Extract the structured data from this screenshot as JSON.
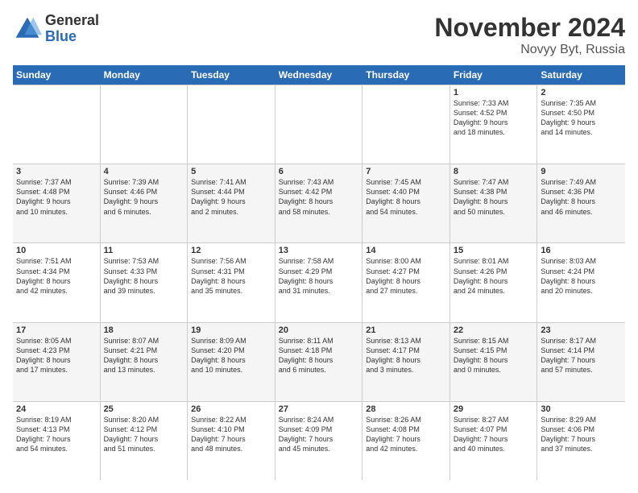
{
  "logo": {
    "general": "General",
    "blue": "Blue"
  },
  "title": "November 2024",
  "location": "Novyy Byt, Russia",
  "weekdays": [
    "Sunday",
    "Monday",
    "Tuesday",
    "Wednesday",
    "Thursday",
    "Friday",
    "Saturday"
  ],
  "rows": [
    [
      {
        "day": "",
        "info": ""
      },
      {
        "day": "",
        "info": ""
      },
      {
        "day": "",
        "info": ""
      },
      {
        "day": "",
        "info": ""
      },
      {
        "day": "",
        "info": ""
      },
      {
        "day": "1",
        "info": "Sunrise: 7:33 AM\nSunset: 4:52 PM\nDaylight: 9 hours\nand 18 minutes."
      },
      {
        "day": "2",
        "info": "Sunrise: 7:35 AM\nSunset: 4:50 PM\nDaylight: 9 hours\nand 14 minutes."
      }
    ],
    [
      {
        "day": "3",
        "info": "Sunrise: 7:37 AM\nSunset: 4:48 PM\nDaylight: 9 hours\nand 10 minutes."
      },
      {
        "day": "4",
        "info": "Sunrise: 7:39 AM\nSunset: 4:46 PM\nDaylight: 9 hours\nand 6 minutes."
      },
      {
        "day": "5",
        "info": "Sunrise: 7:41 AM\nSunset: 4:44 PM\nDaylight: 9 hours\nand 2 minutes."
      },
      {
        "day": "6",
        "info": "Sunrise: 7:43 AM\nSunset: 4:42 PM\nDaylight: 8 hours\nand 58 minutes."
      },
      {
        "day": "7",
        "info": "Sunrise: 7:45 AM\nSunset: 4:40 PM\nDaylight: 8 hours\nand 54 minutes."
      },
      {
        "day": "8",
        "info": "Sunrise: 7:47 AM\nSunset: 4:38 PM\nDaylight: 8 hours\nand 50 minutes."
      },
      {
        "day": "9",
        "info": "Sunrise: 7:49 AM\nSunset: 4:36 PM\nDaylight: 8 hours\nand 46 minutes."
      }
    ],
    [
      {
        "day": "10",
        "info": "Sunrise: 7:51 AM\nSunset: 4:34 PM\nDaylight: 8 hours\nand 42 minutes."
      },
      {
        "day": "11",
        "info": "Sunrise: 7:53 AM\nSunset: 4:33 PM\nDaylight: 8 hours\nand 39 minutes."
      },
      {
        "day": "12",
        "info": "Sunrise: 7:56 AM\nSunset: 4:31 PM\nDaylight: 8 hours\nand 35 minutes."
      },
      {
        "day": "13",
        "info": "Sunrise: 7:58 AM\nSunset: 4:29 PM\nDaylight: 8 hours\nand 31 minutes."
      },
      {
        "day": "14",
        "info": "Sunrise: 8:00 AM\nSunset: 4:27 PM\nDaylight: 8 hours\nand 27 minutes."
      },
      {
        "day": "15",
        "info": "Sunrise: 8:01 AM\nSunset: 4:26 PM\nDaylight: 8 hours\nand 24 minutes."
      },
      {
        "day": "16",
        "info": "Sunrise: 8:03 AM\nSunset: 4:24 PM\nDaylight: 8 hours\nand 20 minutes."
      }
    ],
    [
      {
        "day": "17",
        "info": "Sunrise: 8:05 AM\nSunset: 4:23 PM\nDaylight: 8 hours\nand 17 minutes."
      },
      {
        "day": "18",
        "info": "Sunrise: 8:07 AM\nSunset: 4:21 PM\nDaylight: 8 hours\nand 13 minutes."
      },
      {
        "day": "19",
        "info": "Sunrise: 8:09 AM\nSunset: 4:20 PM\nDaylight: 8 hours\nand 10 minutes."
      },
      {
        "day": "20",
        "info": "Sunrise: 8:11 AM\nSunset: 4:18 PM\nDaylight: 8 hours\nand 6 minutes."
      },
      {
        "day": "21",
        "info": "Sunrise: 8:13 AM\nSunset: 4:17 PM\nDaylight: 8 hours\nand 3 minutes."
      },
      {
        "day": "22",
        "info": "Sunrise: 8:15 AM\nSunset: 4:15 PM\nDaylight: 8 hours\nand 0 minutes."
      },
      {
        "day": "23",
        "info": "Sunrise: 8:17 AM\nSunset: 4:14 PM\nDaylight: 7 hours\nand 57 minutes."
      }
    ],
    [
      {
        "day": "24",
        "info": "Sunrise: 8:19 AM\nSunset: 4:13 PM\nDaylight: 7 hours\nand 54 minutes."
      },
      {
        "day": "25",
        "info": "Sunrise: 8:20 AM\nSunset: 4:12 PM\nDaylight: 7 hours\nand 51 minutes."
      },
      {
        "day": "26",
        "info": "Sunrise: 8:22 AM\nSunset: 4:10 PM\nDaylight: 7 hours\nand 48 minutes."
      },
      {
        "day": "27",
        "info": "Sunrise: 8:24 AM\nSunset: 4:09 PM\nDaylight: 7 hours\nand 45 minutes."
      },
      {
        "day": "28",
        "info": "Sunrise: 8:26 AM\nSunset: 4:08 PM\nDaylight: 7 hours\nand 42 minutes."
      },
      {
        "day": "29",
        "info": "Sunrise: 8:27 AM\nSunset: 4:07 PM\nDaylight: 7 hours\nand 40 minutes."
      },
      {
        "day": "30",
        "info": "Sunrise: 8:29 AM\nSunset: 4:06 PM\nDaylight: 7 hours\nand 37 minutes."
      }
    ]
  ]
}
